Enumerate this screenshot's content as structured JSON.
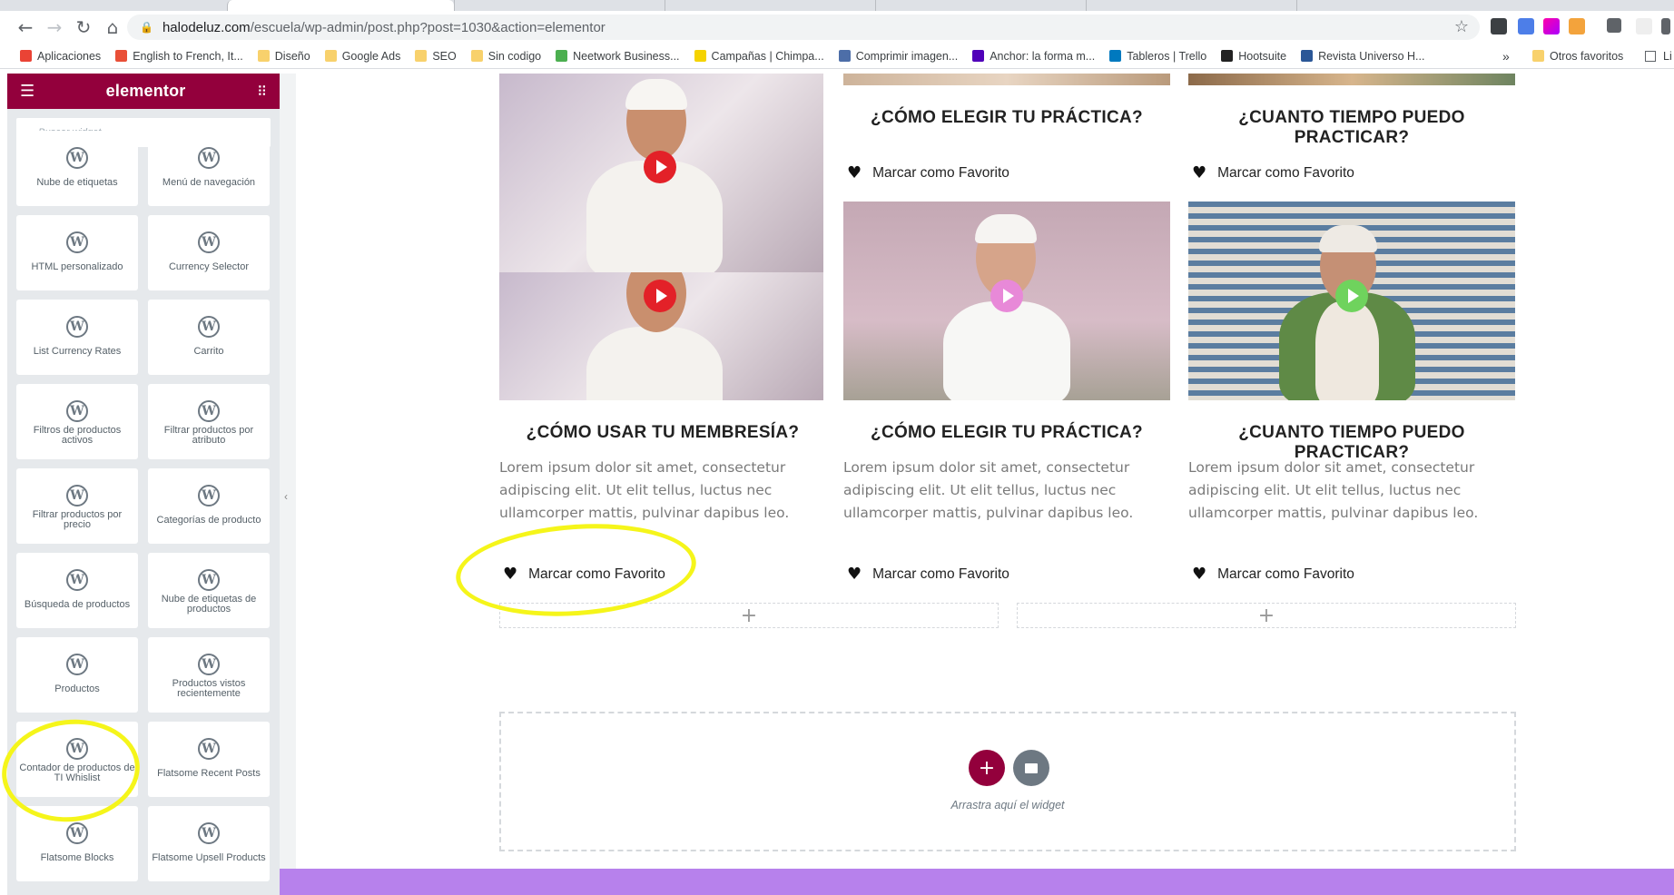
{
  "browser": {
    "url_host": "halodeluz.com",
    "url_path": "/escuela/wp-admin/post.php?post=1030&action=elementor",
    "bookmarks": [
      {
        "label": "Aplicaciones",
        "icon": "apps-grid-icon"
      },
      {
        "label": "English to French, It...",
        "icon": "wr-icon"
      },
      {
        "label": "Diseño",
        "icon": "folder-icon"
      },
      {
        "label": "Google Ads",
        "icon": "folder-icon"
      },
      {
        "label": "SEO",
        "icon": "folder-icon"
      },
      {
        "label": "Sin codigo",
        "icon": "folder-icon"
      },
      {
        "label": "Neetwork Business...",
        "icon": "neetwork-icon"
      },
      {
        "label": "Campañas | Chimpa...",
        "icon": "mailchimp-icon"
      },
      {
        "label": "Comprimir imagen...",
        "icon": "compress-icon"
      },
      {
        "label": "Anchor: la forma m...",
        "icon": "anchor-icon"
      },
      {
        "label": "Tableros | Trello",
        "icon": "trello-icon"
      },
      {
        "label": "Hootsuite",
        "icon": "hootsuite-icon"
      },
      {
        "label": "Revista Universo H...",
        "icon": "bookmark-icon"
      }
    ],
    "more_bookmarks": "»",
    "other_bookmarks": "Otros favoritos",
    "reading_list": "Li"
  },
  "editor": {
    "logo": "elementor",
    "search_placeholder": "Buscar widget...",
    "widgets": [
      "Nube de etiquetas",
      "Menú de navegación",
      "HTML personalizado",
      "Currency Selector",
      "List Currency Rates",
      "Carrito",
      "Filtros de productos activos",
      "Filtrar productos por atributo",
      "Filtrar productos por precio",
      "Categorías de producto",
      "Búsqueda de productos",
      "Nube de etiquetas de productos",
      "Productos",
      "Productos vistos recientemente",
      "Contador de productos de TI Whislist",
      "Flatsome Recent Posts",
      "Flatsome Blocks",
      "Flatsome Upsell Products"
    ]
  },
  "page": {
    "top_titles": [
      "¿CÓMO ELEGIR TU PRÁCTICA?",
      "¿CUANTO TIEMPO PUEDO PRACTICAR?"
    ],
    "favorite_label": "Marcar como Favorito",
    "cards": [
      {
        "title": "¿CÓMO USAR TU MEMBRESÍA?",
        "body": "Lorem ipsum dolor sit amet, consectetur adipiscing elit. Ut elit tellus, luctus nec ullamcorper mattis, pulvinar dapibus leo.",
        "play_color": "#e32128"
      },
      {
        "title": "¿CÓMO ELEGIR TU PRÁCTICA?",
        "body": "Lorem ipsum dolor sit amet, consectetur adipiscing elit. Ut elit tellus, luctus nec ullamcorper mattis, pulvinar dapibus leo.",
        "play_color": "#e889d8"
      },
      {
        "title": "¿CUANTO TIEMPO PUEDO PRACTICAR?",
        "body": "Lorem ipsum dolor sit amet, consectetur adipiscing elit. Ut elit tellus, luctus nec ullamcorper mattis, pulvinar dapibus leo.",
        "play_color": "#6fd35d"
      }
    ],
    "add_icon": "+",
    "drop_text": "Arrastra aquí el widget"
  },
  "colors": {
    "elementor_brand": "#93003c",
    "highlight": "#f5f51a",
    "footer_band": "#b781ec"
  }
}
